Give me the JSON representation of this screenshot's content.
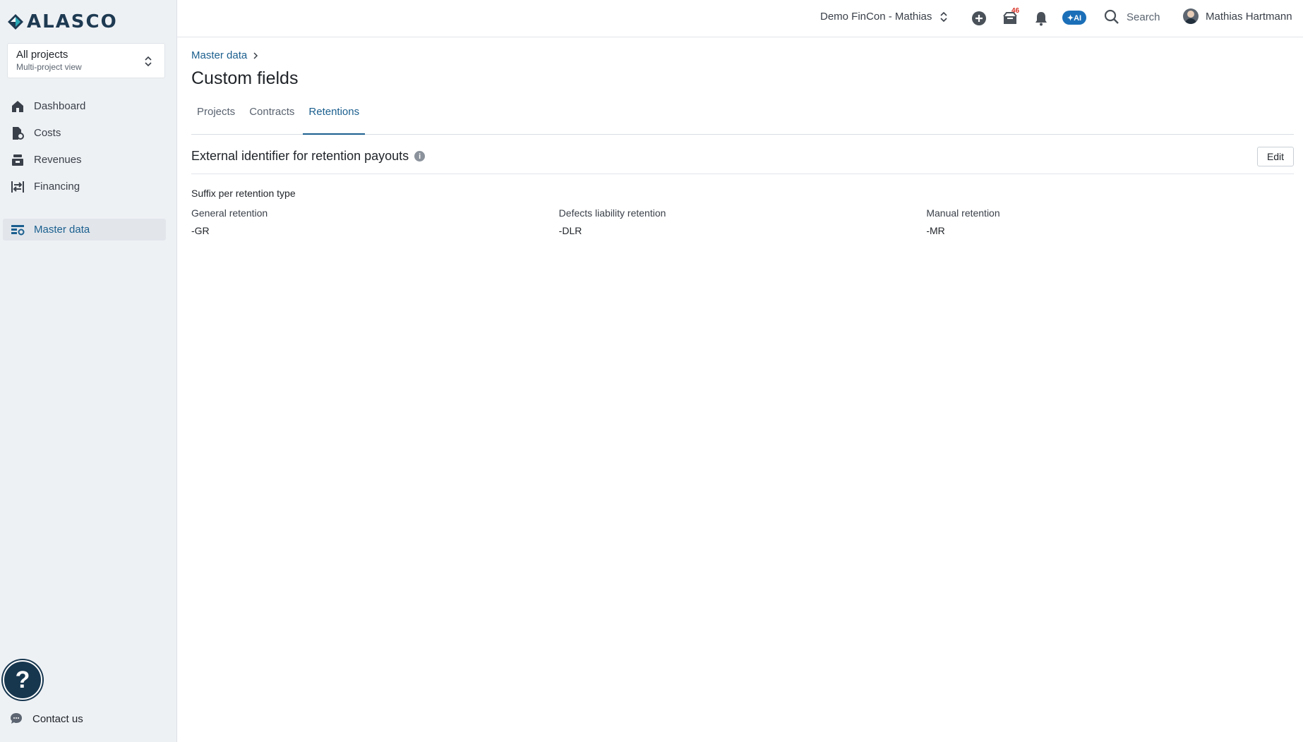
{
  "sidebar": {
    "logo_text": "ALASCO",
    "project_selector": {
      "title": "All projects",
      "subtitle": "Multi-project view"
    },
    "nav": [
      {
        "label": "Dashboard",
        "icon": "home-icon"
      },
      {
        "label": "Costs",
        "icon": "costs-icon"
      },
      {
        "label": "Revenues",
        "icon": "revenues-icon"
      },
      {
        "label": "Financing",
        "icon": "financing-icon"
      },
      {
        "label": "Master data",
        "icon": "master-data-icon",
        "active": true
      }
    ],
    "help_label": "?",
    "contact_label": "Contact us"
  },
  "topbar": {
    "workspace": "Demo FinCon - Mathias",
    "inbox_badge": "46",
    "ai_label": "✦AI",
    "search_label": "Search",
    "user_name": "Mathias Hartmann"
  },
  "main": {
    "breadcrumb": "Master data",
    "title": "Custom fields",
    "tabs": [
      {
        "label": "Projects"
      },
      {
        "label": "Contracts"
      },
      {
        "label": "Retentions",
        "active": true
      }
    ],
    "section": {
      "title": "External identifier for retention payouts",
      "edit_label": "Edit",
      "subheading": "Suffix per retention type",
      "columns": [
        {
          "label": "General retention",
          "value": "-GR"
        },
        {
          "label": "Defects liability retention",
          "value": "-DLR"
        },
        {
          "label": "Manual retention",
          "value": "-MR"
        }
      ]
    }
  },
  "colors": {
    "accent": "#1b5f8e",
    "sidebar_bg": "#eef1f4",
    "help_bg": "#17374f",
    "ai_pill": "#1b6fb8"
  }
}
